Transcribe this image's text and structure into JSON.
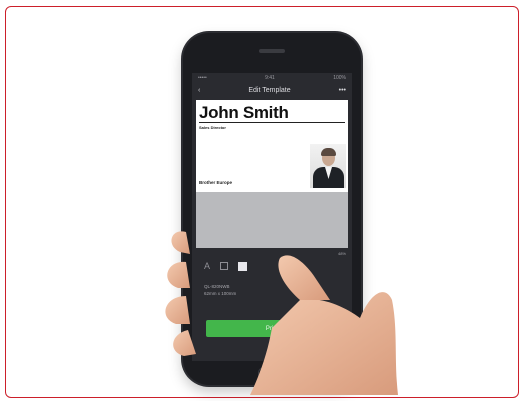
{
  "phone": {
    "status_left": "••••• ",
    "status_center": "9:41",
    "status_right": "100%",
    "nav_back": "‹",
    "nav_title": "Edit Template",
    "nav_more": "•••"
  },
  "badge": {
    "name": "John Smith",
    "role": "Sales Director",
    "company": "Brother Europe"
  },
  "editor": {
    "zoom": "48%",
    "tool_text": "A",
    "label_size": "QL-820NWB",
    "label_dims": "62mm x 100mm",
    "print_label": "Print"
  },
  "colors": {
    "frame_border": "#cc1f2a",
    "print_button": "#43b64b"
  }
}
